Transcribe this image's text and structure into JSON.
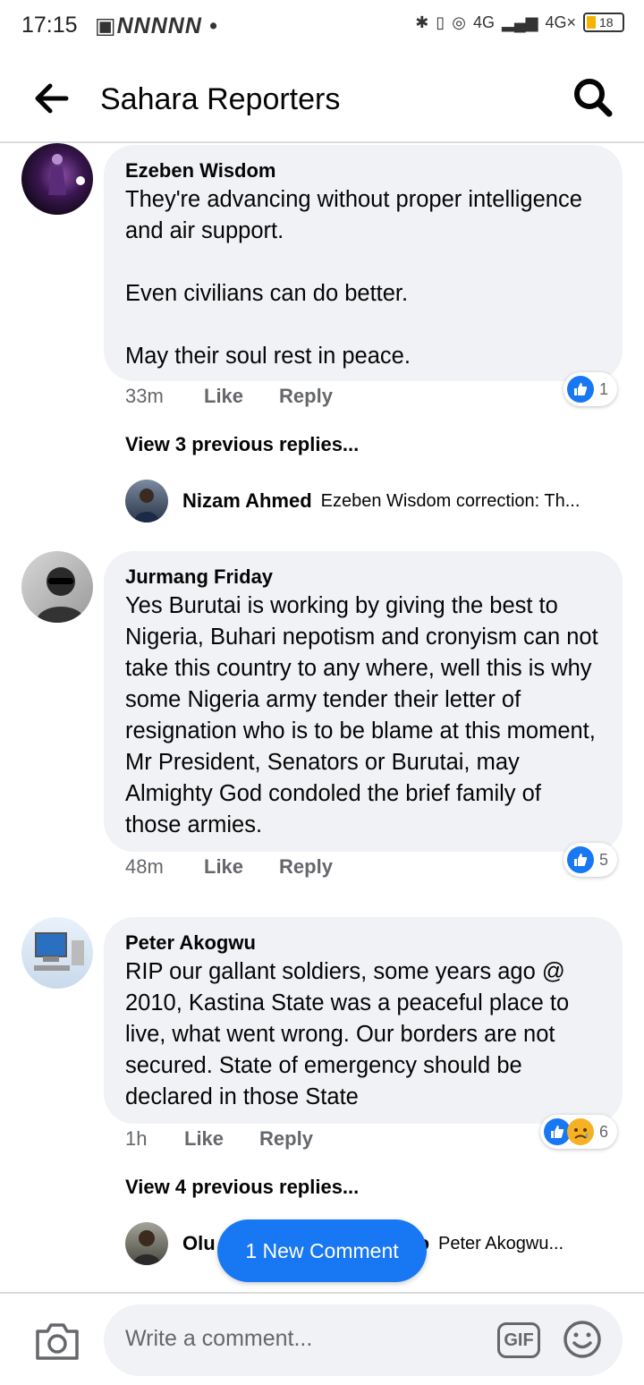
{
  "status_bar": {
    "time": "17:15",
    "left_icons": "▣NNNNN •",
    "network_1": "4G",
    "network_2": "4G×",
    "battery": "18"
  },
  "header": {
    "title": "Sahara Reporters"
  },
  "comments": [
    {
      "author": "Ezeben Wisdom",
      "text": "They're advancing without proper intelligence and air support.\n\nEven civilians can do better.\n\nMay their soul rest in peace.",
      "time": "33m",
      "like_label": "Like",
      "reply_label": "Reply",
      "reaction_count": "1",
      "view_replies": "View 3 previous replies...",
      "reply_preview": {
        "author": "Nizam Ahmed",
        "snippet": "Ezeben Wisdom  correction: Th..."
      }
    },
    {
      "author": "Jurmang Friday",
      "text": "Yes Burutai is working by giving the best to Nigeria, Buhari nepotism and cronyism can not take this country to any where, well this is why some Nigeria army tender their letter of resignation who is to be blame at this moment, Mr President, Senators or Burutai, may Almighty God condoled the brief family of those armies.",
      "time": "48m",
      "like_label": "Like",
      "reply_label": "Reply",
      "reaction_count": "5"
    },
    {
      "author": "Peter Akogwu",
      "text": "RIP our gallant soldiers, some years ago @ 2010,  Kastina State was a peaceful place to live, what went wrong. Our borders are not secured. State of emergency should be declared in those State",
      "time": "1h",
      "like_label": "Like",
      "reply_label": "Reply",
      "reaction_count": "6",
      "view_replies": "View 4 previous replies...",
      "reply_preview": {
        "author_start": "Olu",
        "author_end": "bayo",
        "snippet": "Peter Akogwu..."
      }
    }
  ],
  "new_comment_pill": "1 New Comment",
  "composer": {
    "placeholder": "Write a comment...",
    "gif_label": "GIF"
  },
  "colors": {
    "accent": "#1877f2",
    "bubble": "#f0f2f5",
    "secondary_text": "#65676b"
  }
}
